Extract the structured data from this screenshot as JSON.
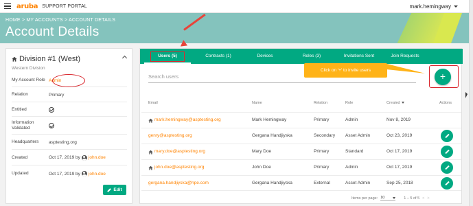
{
  "topbar": {
    "logo": "aruba",
    "portal_name": "SUPPORT PORTAL",
    "user": "mark.hemingway"
  },
  "banner": {
    "breadcrumb": [
      "HOME",
      "MY ACCOUNTS",
      "ACCOUNT DETAILS"
    ],
    "separator": " > ",
    "title": "Account Details"
  },
  "division": {
    "title": "Division #1 (West)",
    "subtitle": "Western Division",
    "fields": [
      {
        "label": "My Account Role",
        "value": "Admin"
      },
      {
        "label": "Relation",
        "value": "Primary"
      },
      {
        "label": "Entitled",
        "value": ""
      },
      {
        "label": "Information Validated",
        "value": ""
      },
      {
        "label": "Headquarters",
        "value": "asptesting.org"
      },
      {
        "label": "Created",
        "value": "Oct 17, 2019 by",
        "by": "john.doe"
      },
      {
        "label": "Updated",
        "value": "Oct 17, 2019 by",
        "by": "john.doe"
      }
    ],
    "edit_label": "Edit"
  },
  "tabs": [
    {
      "label": "Users (5)",
      "active": true
    },
    {
      "label": "Contracts (1)"
    },
    {
      "label": "Devices"
    },
    {
      "label": "Roles (3)"
    },
    {
      "label": "Invitations Sent"
    },
    {
      "label": "Join Requests"
    }
  ],
  "search": {
    "placeholder": "Search users"
  },
  "tooltip": "Click on '+' to invite users",
  "add_label": "+",
  "table": {
    "headers": [
      "Email",
      "Name",
      "Relation",
      "Role",
      "Created",
      "Actions"
    ],
    "rows": [
      {
        "email": "mark.hemingway@asptesting.org",
        "home": true,
        "name": "Mark Hemingway",
        "relation": "Primary",
        "role": "Admin",
        "created": "Nov 8, 2019",
        "action": false
      },
      {
        "email": "genry@asptesting.org",
        "home": false,
        "name": "Gergana Handjiyska",
        "relation": "Secondary",
        "role": "Asset Admin",
        "created": "Oct 23, 2019",
        "action": true
      },
      {
        "email": "mary.doe@asptesting.org",
        "home": true,
        "name": "Mary Doe",
        "relation": "Primary",
        "role": "Standard",
        "created": "Oct 17, 2019",
        "action": true
      },
      {
        "email": "john.doe@asptesting.org",
        "home": true,
        "name": "John Doe",
        "relation": "Primary",
        "role": "Admin",
        "created": "Oct 17, 2019",
        "action": true
      },
      {
        "email": "gergana.handjiyska@hpe.com",
        "home": false,
        "name": "Gergana Handjiyska",
        "relation": "External",
        "role": "Asset Admin",
        "created": "Sep 25, 2018",
        "action": true
      }
    ]
  },
  "pager": {
    "items_label": "Items per page:",
    "per_page": "10",
    "range": "1 – 5 of 5",
    "prev": "<",
    "next": ">"
  },
  "colors": {
    "accent": "#01a982",
    "orange": "#ff8300",
    "banner": "#84c3bd",
    "annotation": "#d9272e",
    "tooltip": "#ffb318"
  }
}
